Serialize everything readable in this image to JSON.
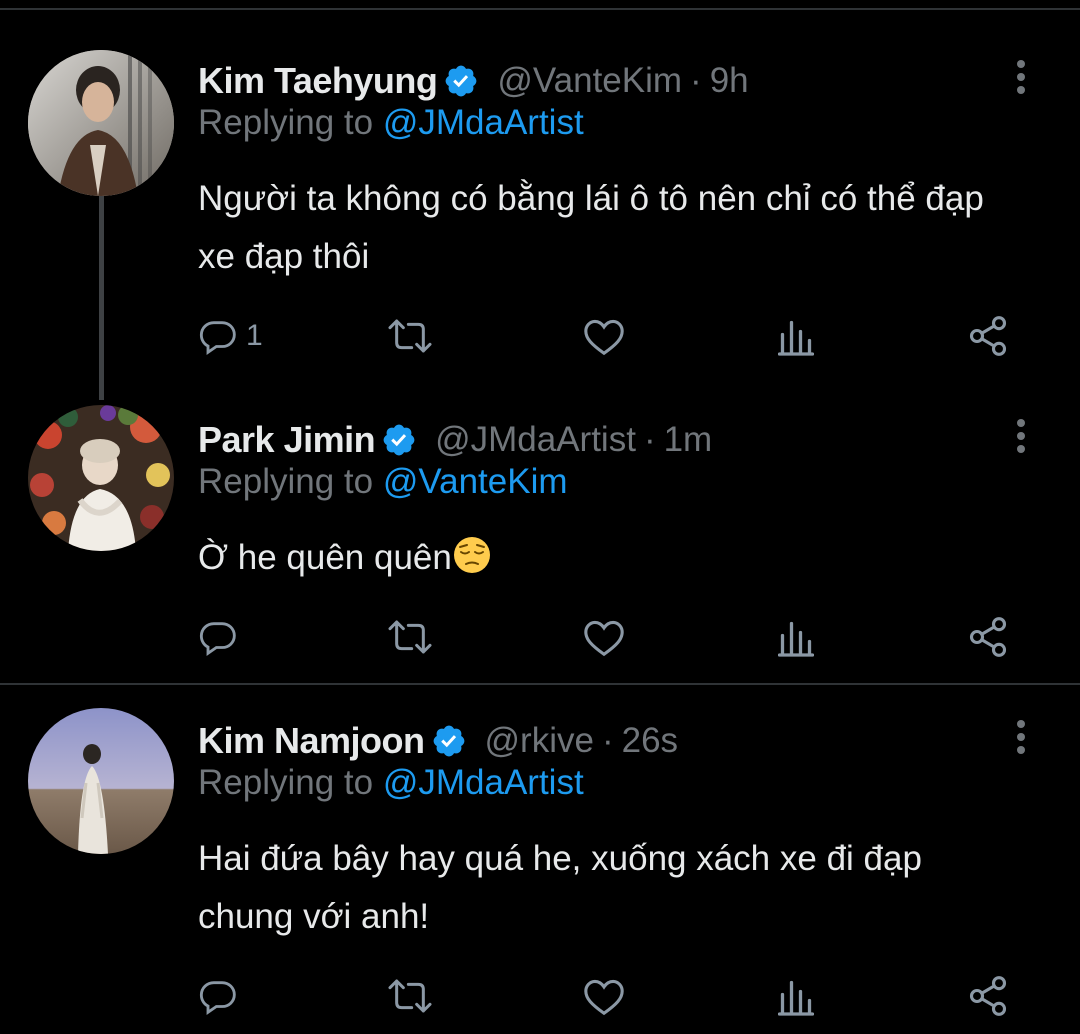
{
  "tweets": [
    {
      "name": "Kim Taehyung",
      "handle": "@VanteKim",
      "separator": "·",
      "time": "9h",
      "replying_prefix": "Replying to ",
      "replying_to": "@JMdaArtist",
      "text": "Người ta không có bằng lái ô tô nên chỉ có thể đạp xe đạp thôi",
      "reply_count": "1"
    },
    {
      "name": "Park Jimin",
      "handle": "@JMdaArtist",
      "separator": "·",
      "time": "1m",
      "replying_prefix": "Replying to ",
      "replying_to": "@VanteKim",
      "text": "Ờ he quên quên",
      "emoji": "pensive-face-emoji",
      "reply_count": ""
    },
    {
      "name": "Kim Namjoon",
      "handle": "@rkive",
      "separator": "·",
      "time": "26s",
      "replying_prefix": "Replying to ",
      "replying_to": "@JMdaArtist",
      "text": "Hai đứa bây hay quá he, xuống xách xe đi đạp chung với anh!",
      "reply_count": ""
    }
  ],
  "icons": {
    "verified": "verified-badge-icon",
    "more": "more-vertical-icon",
    "reply": "reply-icon",
    "retweet": "retweet-icon",
    "like": "heart-icon",
    "views": "views-icon",
    "share": "share-icon"
  },
  "colors": {
    "background": "#000000",
    "primary_text": "#e7e9ea",
    "secondary_text": "#71767b",
    "accent": "#1d9bf0",
    "divider": "#2f3336",
    "icon": "#8b98a5"
  }
}
